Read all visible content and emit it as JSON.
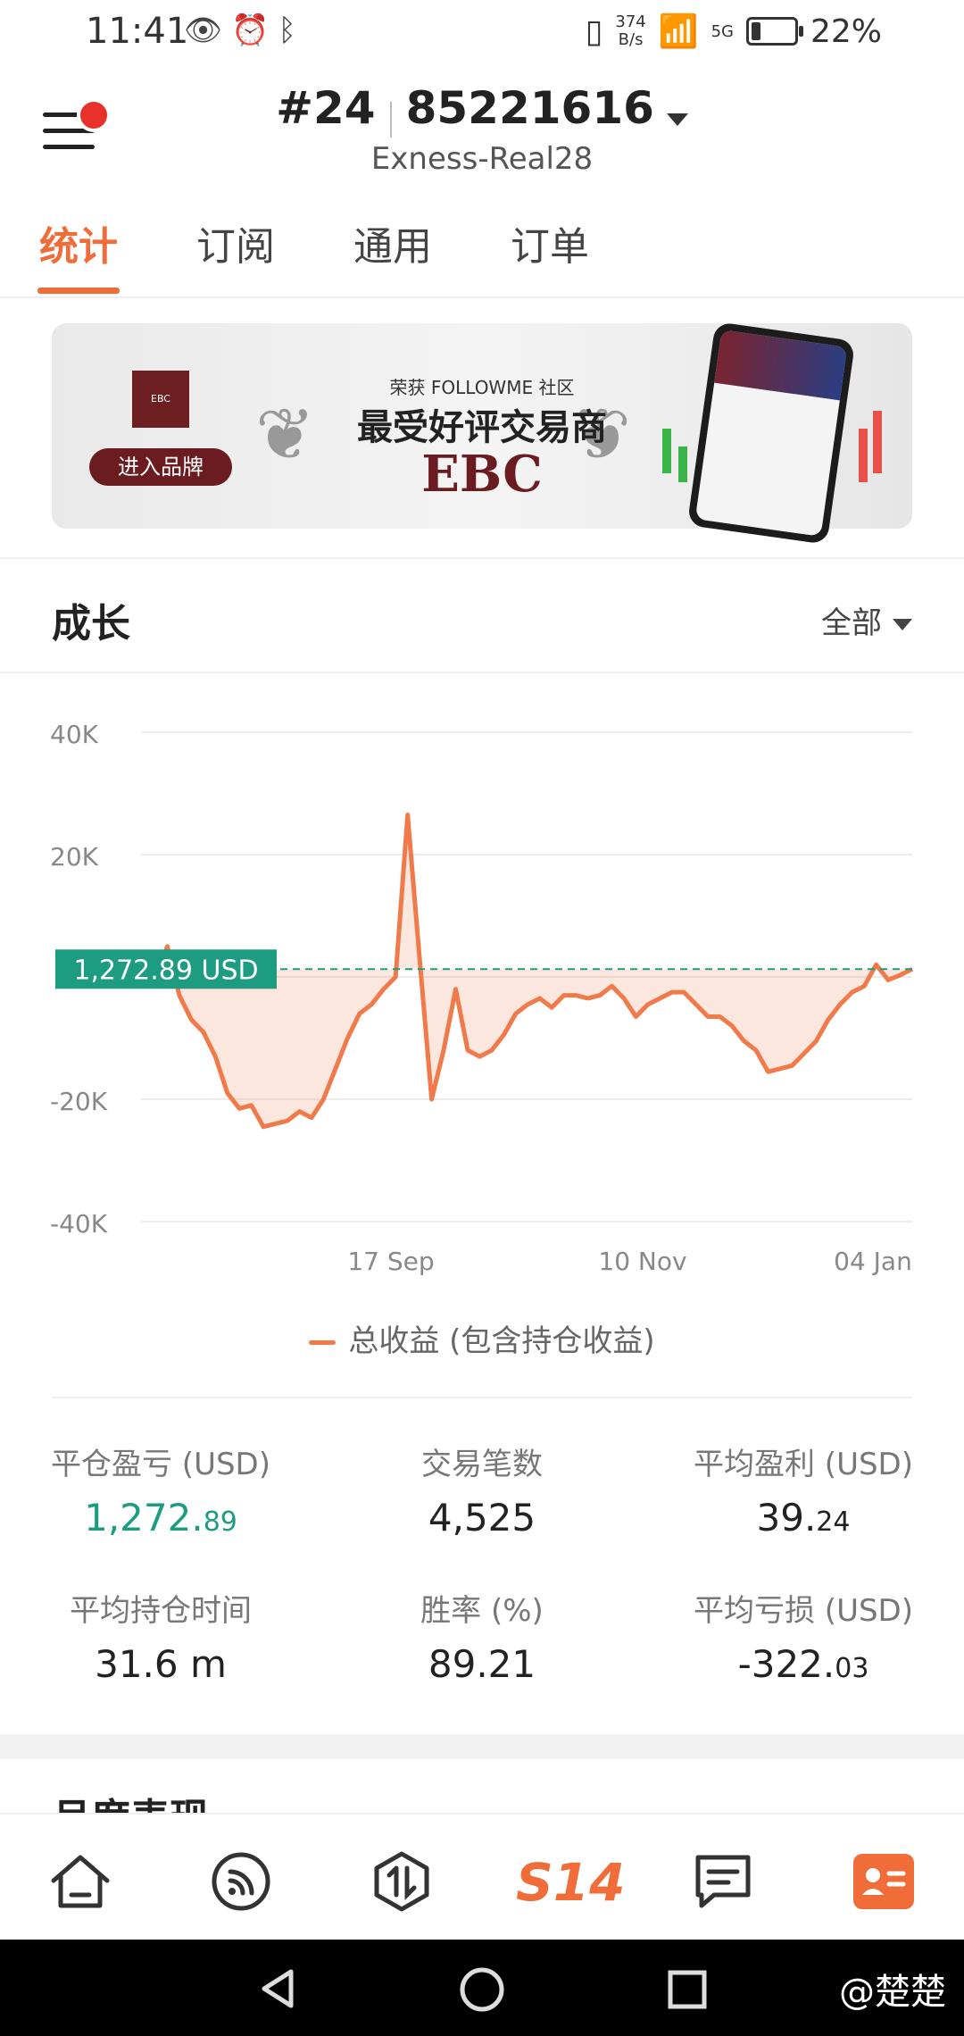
{
  "status_bar": {
    "time": "11:41",
    "net_speed_value": "374",
    "net_speed_unit": "B/s",
    "signal_tag": "5G",
    "battery_percent": "22%",
    "battery_level": 0.22
  },
  "header": {
    "rank": "#24",
    "account_number": "85221616",
    "server": "Exness-Real28"
  },
  "tabs": [
    {
      "label": "统计",
      "active": true
    },
    {
      "label": "订阅",
      "active": false
    },
    {
      "label": "通用",
      "active": false
    },
    {
      "label": "订单",
      "active": false
    }
  ],
  "banner": {
    "logo_text": "EBC",
    "button_label": "进入品牌",
    "line1": "荣获 FOLLOWME 社区",
    "line2": "最受好评交易商",
    "line3": "EBC"
  },
  "growth": {
    "title": "成长",
    "range_label": "全部"
  },
  "chart_data": {
    "type": "area",
    "y_ticks": [
      "40K",
      "20K",
      "0",
      "-20K",
      "-40K"
    ],
    "ylim": [
      -40000,
      40000
    ],
    "x_ticks": [
      "17 Sep",
      "10 Nov",
      "04 Jan"
    ],
    "current_value_label": "1,272.89 USD",
    "current_value": 1272.89,
    "series": [
      {
        "name": "总收益 (包含持仓收益)",
        "color": "#f07a4a",
        "values": [
          0,
          5000,
          -3000,
          -7000,
          -9000,
          -13000,
          -19000,
          -21500,
          -21000,
          -24500,
          -24000,
          -23500,
          -22000,
          -23000,
          -20000,
          -15000,
          -10000,
          -6000,
          -4500,
          -2000,
          0,
          26500,
          3000,
          -20000,
          -12000,
          -2000,
          -12000,
          -13000,
          -12000,
          -9500,
          -6000,
          -4500,
          -3500,
          -5000,
          -3000,
          -3000,
          -3500,
          -3000,
          -1500,
          -3500,
          -6500,
          -4500,
          -3500,
          -2500,
          -2500,
          -4500,
          -6500,
          -6500,
          -8000,
          -10500,
          -12000,
          -15500,
          -15000,
          -14500,
          -12500,
          -10500,
          -7000,
          -4500,
          -2500,
          -1500,
          2000,
          -500,
          300,
          1272.89
        ]
      }
    ]
  },
  "legend_label": "总收益 (包含持仓收益)",
  "stats": [
    {
      "label": "平仓盈亏 (USD)",
      "int": "1,272.",
      "dec": "89",
      "green": true
    },
    {
      "label": "交易笔数",
      "int": "4,525",
      "dec": "",
      "green": false
    },
    {
      "label": "平均盈利 (USD)",
      "int": "39.",
      "dec": "24",
      "green": false
    },
    {
      "label": "平均持仓时间",
      "int": "31.6 m",
      "dec": "",
      "green": false
    },
    {
      "label": "胜率 (%)",
      "int": "89.21",
      "dec": "",
      "green": false
    },
    {
      "label": "平均亏损 (USD)",
      "int": "-322.",
      "dec": "03",
      "green": false
    }
  ],
  "next_section_title": "月度表现",
  "bottom_nav": [
    {
      "name": "home-icon"
    },
    {
      "name": "feed-icon"
    },
    {
      "name": "trade-icon"
    },
    {
      "name": "s14-icon",
      "label": "S14"
    },
    {
      "name": "messages-icon"
    },
    {
      "name": "profile-card-icon"
    }
  ],
  "watermark": "@楚楚"
}
